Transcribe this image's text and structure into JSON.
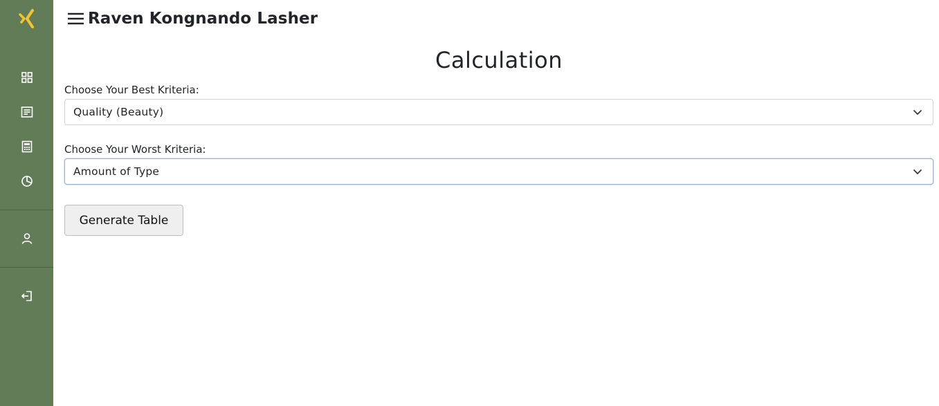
{
  "header": {
    "brand": "Raven Kongnando Lasher"
  },
  "sidebar": {
    "items": [
      {
        "icon": "dashboard-grid-icon"
      },
      {
        "icon": "document-list-icon"
      },
      {
        "icon": "calculator-icon"
      },
      {
        "icon": "pie-chart-icon"
      },
      {
        "icon": "user-icon"
      },
      {
        "icon": "logout-icon"
      }
    ],
    "logo_icon": "logo-icon"
  },
  "main": {
    "title": "Calculation",
    "best": {
      "label": "Choose Your Best Kriteria:",
      "value": "Quality (Beauty)"
    },
    "worst": {
      "label": "Choose Your Worst Kriteria:",
      "value": "Amount of Type"
    },
    "generate_label": "Generate Table"
  },
  "colors": {
    "sidebar": "#627c58",
    "logo": "#f2c531",
    "icon": "#ffffff"
  }
}
